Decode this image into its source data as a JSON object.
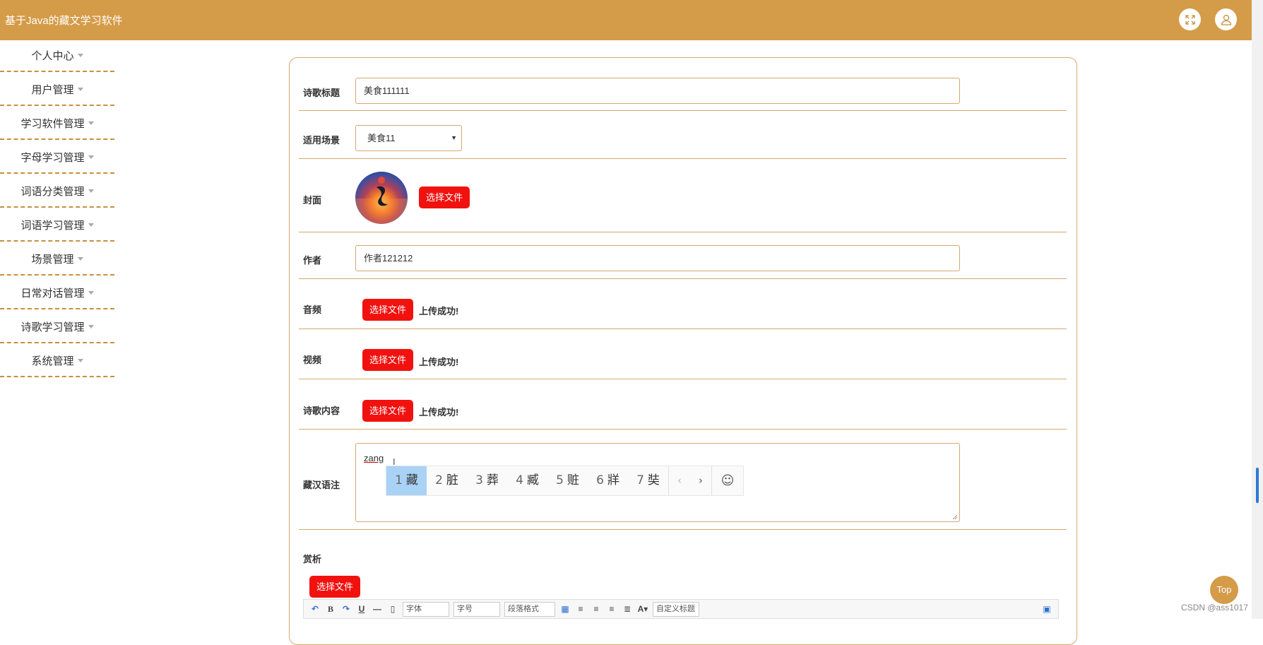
{
  "header": {
    "title": "基于Java的藏文学习软件",
    "fullscreen_icon": "expand-icon",
    "user_icon": "user-icon",
    "color": "#d49b48"
  },
  "sidebar": {
    "items": [
      {
        "label": "个人中心"
      },
      {
        "label": "用户管理"
      },
      {
        "label": "学习软件管理"
      },
      {
        "label": "字母学习管理"
      },
      {
        "label": "词语分类管理"
      },
      {
        "label": "词语学习管理"
      },
      {
        "label": "场景管理"
      },
      {
        "label": "日常对话管理"
      },
      {
        "label": "诗歌学习管理"
      },
      {
        "label": "系统管理"
      }
    ]
  },
  "form": {
    "title_label": "诗歌标题",
    "title_value": "美食111111",
    "scene_label": "适用场景",
    "scene_value": "美食11",
    "cover_label": "封面",
    "cover_button": "选择文件",
    "author_label": "作者",
    "author_value": "作者121212",
    "audio_label": "音频",
    "audio_button": "选择文件",
    "audio_status": "上传成功!",
    "video_label": "视频",
    "video_button": "选择文件",
    "video_status": "上传成功!",
    "content_label": "诗歌内容",
    "content_button": "选择文件",
    "content_status": "上传成功!",
    "annotation_label": "藏汉语注",
    "annotation_typed": "zang",
    "appreciation_label": "赏析",
    "appreciation_button": "选择文件"
  },
  "ime": {
    "candidates": [
      {
        "num": "1",
        "text": "藏"
      },
      {
        "num": "2",
        "text": "脏"
      },
      {
        "num": "3",
        "text": "葬"
      },
      {
        "num": "4",
        "text": "臧"
      },
      {
        "num": "5",
        "text": "赃"
      },
      {
        "num": "6",
        "text": "牂"
      },
      {
        "num": "7",
        "text": "奘"
      }
    ],
    "prev": "‹",
    "next": "›",
    "emoji": "☺"
  },
  "editor_toolbar": {
    "font_label": "字体",
    "size_label": "字号",
    "para_label": "段落格式",
    "custom_label": "自定义标题"
  },
  "top_button": "Top",
  "watermark": "CSDN @ass1017"
}
